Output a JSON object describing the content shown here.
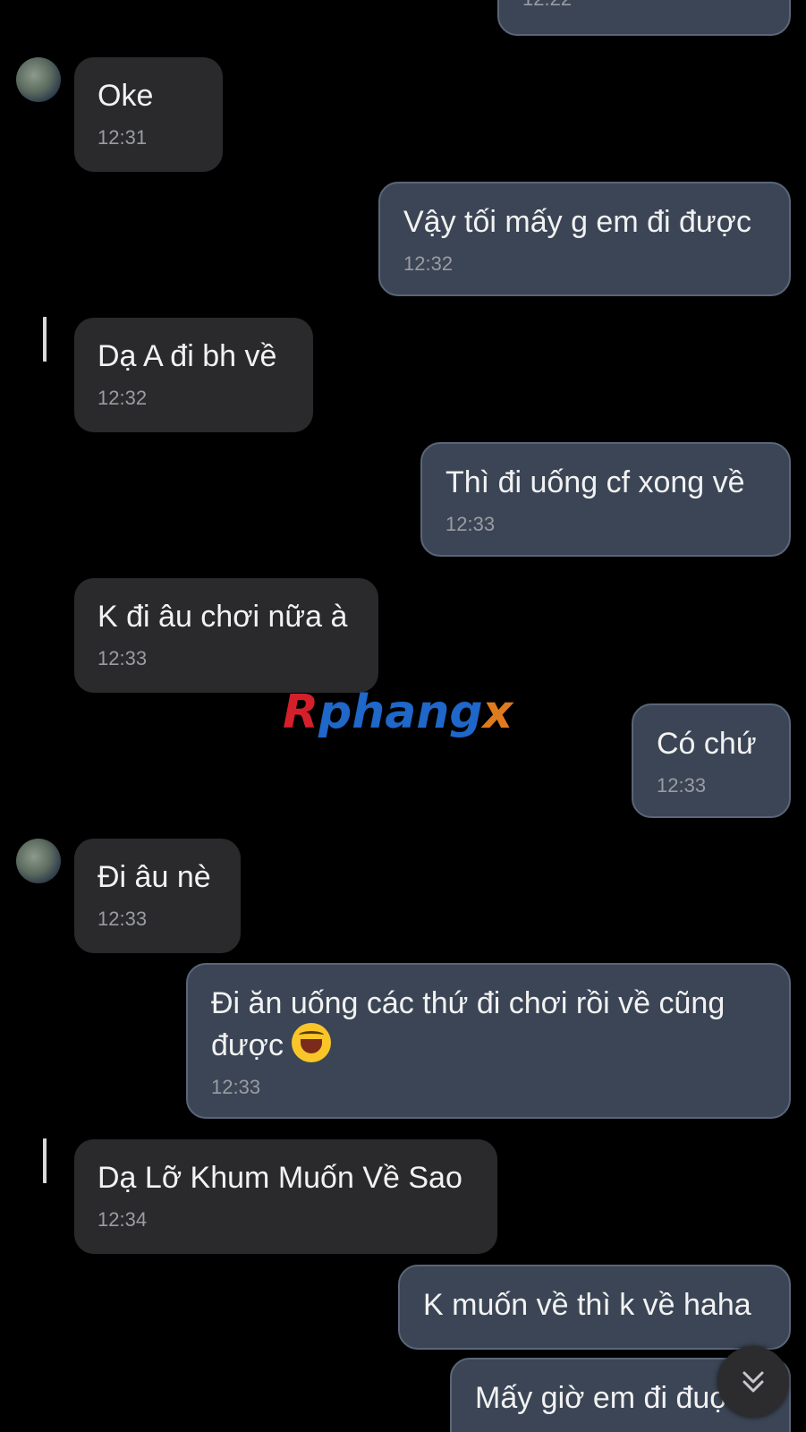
{
  "messages": [
    {
      "text": "",
      "time": "12:22"
    },
    {
      "text": "Oke",
      "time": "12:31"
    },
    {
      "text": "Vậy tối mấy g em đi được",
      "time": "12:32"
    },
    {
      "text": "Dạ A đi bh về",
      "time": "12:32"
    },
    {
      "text": "Thì đi uống cf xong về",
      "time": "12:33"
    },
    {
      "text": "K đi âu chơi nữa à",
      "time": "12:33"
    },
    {
      "text": "Có chứ",
      "time": "12:33"
    },
    {
      "text": "Đi âu nè",
      "time": "12:33"
    },
    {
      "text": "Đi ăn uống các thứ đi chơi rồi về cũng được",
      "time": "12:33"
    },
    {
      "text": "Dạ Lỡ Khum Muốn Về Sao",
      "time": "12:34"
    },
    {
      "text": "K muốn về thì k về haha",
      "time": ""
    },
    {
      "text": "Mấy giờ em đi đuợ",
      "time": ""
    }
  ],
  "watermark": {
    "part1": "R",
    "part2": "phang",
    "part3": "x"
  },
  "icons": {
    "avatar": "avatar-photo",
    "emoji": "laughing-emoji",
    "scroll": "chevron-double-down-icon"
  },
  "colors": {
    "background": "#000000",
    "incoming_bubble": "#2a2a2c",
    "outgoing_bubble": "#3b4555"
  }
}
